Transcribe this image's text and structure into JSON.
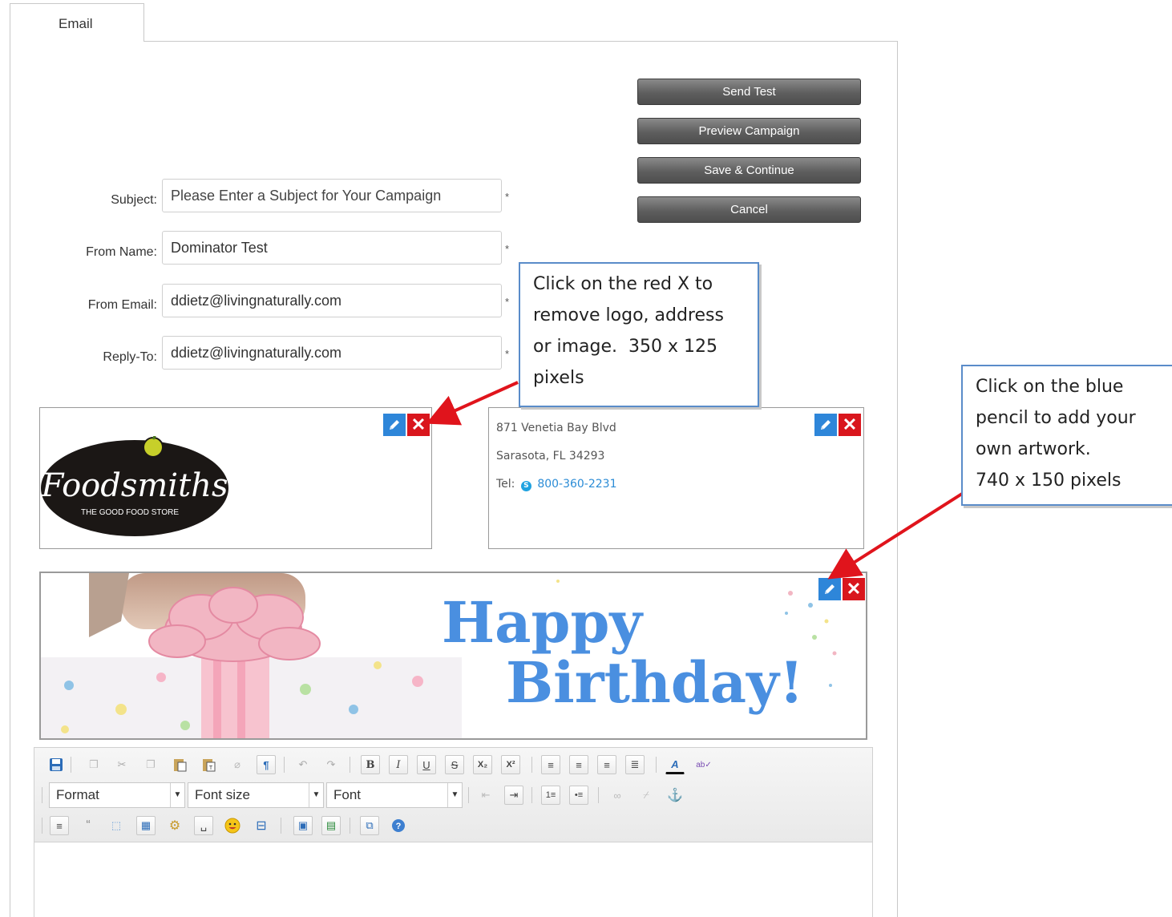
{
  "tab": {
    "label": "Email"
  },
  "actions": {
    "send_test": "Send Test",
    "preview": "Preview Campaign",
    "save_continue": "Save & Continue",
    "cancel": "Cancel"
  },
  "form": {
    "subject": {
      "label": "Subject:",
      "placeholder": "Please Enter a Subject for Your Campaign",
      "value": ""
    },
    "from_name": {
      "label": "From Name:",
      "value": "Dominator Test"
    },
    "from_email": {
      "label": "From Email:",
      "value": "ddietz@livingnaturally.com"
    },
    "reply_to": {
      "label": "Reply-To:",
      "value": "ddietz@livingnaturally.com"
    },
    "required_mark": "*"
  },
  "logo": {
    "brand": "Foodsmiths",
    "tagline": "THE GOOD FOOD STORE"
  },
  "address": {
    "line1": "871 Venetia Bay Blvd",
    "line2": "Sarasota, FL 34293",
    "tel_label": "Tel:",
    "phone": "800-360-2231"
  },
  "banner": {
    "line1": "Happy",
    "line2": "Birthday!"
  },
  "callouts": {
    "left": [
      "Click on the red X to",
      "remove logo, address",
      "or image.  350 x 125",
      "pixels"
    ],
    "right": [
      "Click on the blue",
      "pencil to add your",
      "own artwork.",
      "740 x 150 pixels"
    ]
  },
  "editor": {
    "format": "Format",
    "font_size": "Font size",
    "font": "Font"
  },
  "colors": {
    "edit_blue": "#2e86d9",
    "delete_red": "#d9161d",
    "banner_text": "#4a8fe0",
    "callout_border": "#5a8cc9"
  }
}
